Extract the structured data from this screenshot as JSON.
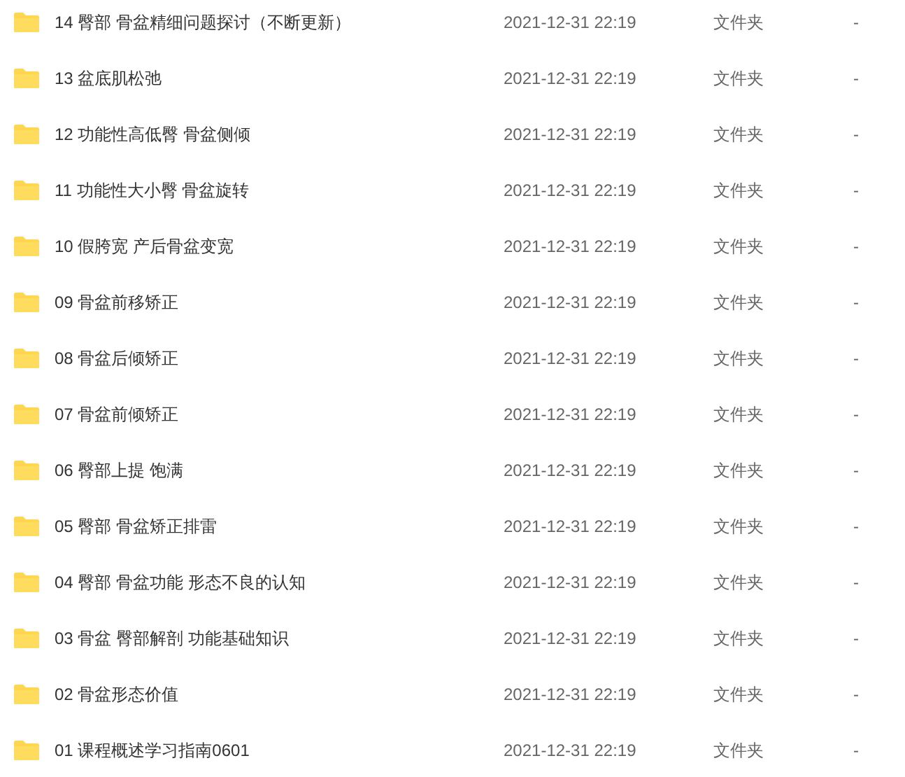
{
  "files": [
    {
      "name": "14 臀部 骨盆精细问题探讨（不断更新）",
      "modified": "2021-12-31 22:19",
      "type": "文件夹",
      "size": "-"
    },
    {
      "name": "13 盆底肌松弛",
      "modified": "2021-12-31 22:19",
      "type": "文件夹",
      "size": "-"
    },
    {
      "name": "12 功能性高低臀 骨盆侧倾",
      "modified": "2021-12-31 22:19",
      "type": "文件夹",
      "size": "-"
    },
    {
      "name": "11 功能性大小臀 骨盆旋转",
      "modified": "2021-12-31 22:19",
      "type": "文件夹",
      "size": "-"
    },
    {
      "name": "10 假胯宽 产后骨盆变宽",
      "modified": "2021-12-31 22:19",
      "type": "文件夹",
      "size": "-"
    },
    {
      "name": "09 骨盆前移矫正",
      "modified": "2021-12-31 22:19",
      "type": "文件夹",
      "size": "-"
    },
    {
      "name": "08 骨盆后倾矫正",
      "modified": "2021-12-31 22:19",
      "type": "文件夹",
      "size": "-"
    },
    {
      "name": "07 骨盆前倾矫正",
      "modified": "2021-12-31 22:19",
      "type": "文件夹",
      "size": "-"
    },
    {
      "name": "06 臀部上提 饱满",
      "modified": "2021-12-31 22:19",
      "type": "文件夹",
      "size": "-"
    },
    {
      "name": "05 臀部 骨盆矫正排雷",
      "modified": "2021-12-31 22:19",
      "type": "文件夹",
      "size": "-"
    },
    {
      "name": "04 臀部 骨盆功能 形态不良的认知",
      "modified": "2021-12-31 22:19",
      "type": "文件夹",
      "size": "-"
    },
    {
      "name": "03 骨盆 臀部解剖 功能基础知识",
      "modified": "2021-12-31 22:19",
      "type": "文件夹",
      "size": "-"
    },
    {
      "name": "02 骨盆形态价值",
      "modified": "2021-12-31 22:19",
      "type": "文件夹",
      "size": "-"
    },
    {
      "name": "01 课程概述学习指南0601",
      "modified": "2021-12-31 22:19",
      "type": "文件夹",
      "size": "-"
    }
  ]
}
